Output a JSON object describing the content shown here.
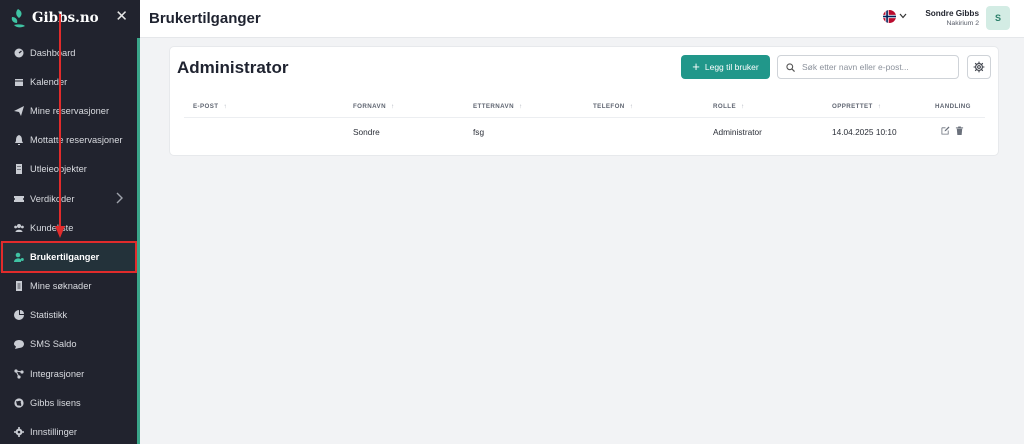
{
  "app": {
    "logo_text": "Gibbs.no"
  },
  "sidebar": {
    "items": [
      {
        "label": "Dashboard",
        "icon": "dashboard-icon"
      },
      {
        "label": "Kalender",
        "icon": "calendar-icon"
      },
      {
        "label": "Mine reservasjoner",
        "icon": "send-icon"
      },
      {
        "label": "Mottatte reservasjoner",
        "icon": "bell-icon"
      },
      {
        "label": "Utleieobjekter",
        "icon": "building-icon"
      },
      {
        "label": "Verdikoder",
        "icon": "ticket-icon"
      },
      {
        "label": "Kundeliste",
        "icon": "users-icon"
      },
      {
        "label": "Brukertilganger",
        "icon": "user-key-icon"
      },
      {
        "label": "Mine søknader",
        "icon": "document-icon"
      },
      {
        "label": "Statistikk",
        "icon": "pie-chart-icon"
      },
      {
        "label": "SMS Saldo",
        "icon": "chat-icon"
      },
      {
        "label": "Integrasjoner",
        "icon": "integration-icon"
      },
      {
        "label": "Gibbs lisens",
        "icon": "globe-icon"
      },
      {
        "label": "Innstillinger",
        "icon": "gear-icon"
      }
    ],
    "active_label": "Brukertilganger"
  },
  "header": {
    "title": "Brukertilganger",
    "user_name": "Sondre Gibbs",
    "user_org": "Nakirium 2",
    "avatar_initial": "S"
  },
  "card": {
    "title": "Administrator",
    "add_button_label": "Legg til bruker",
    "search_placeholder": "Søk etter navn eller e-post...",
    "columns": [
      "E-POST",
      "FORNAVN",
      "ETTERNAVN",
      "TELEFON",
      "ROLLE",
      "OPPRETTET",
      "HANDLING"
    ],
    "rows": [
      {
        "email": "",
        "first_name": "Sondre",
        "last_name": "fsg",
        "phone": "",
        "role": "Administrator",
        "created": "14.04.2025 10:10"
      }
    ]
  },
  "colors": {
    "accent": "#21978a",
    "sidebar_bg": "#21232e",
    "annotation": "#e12b2b"
  }
}
